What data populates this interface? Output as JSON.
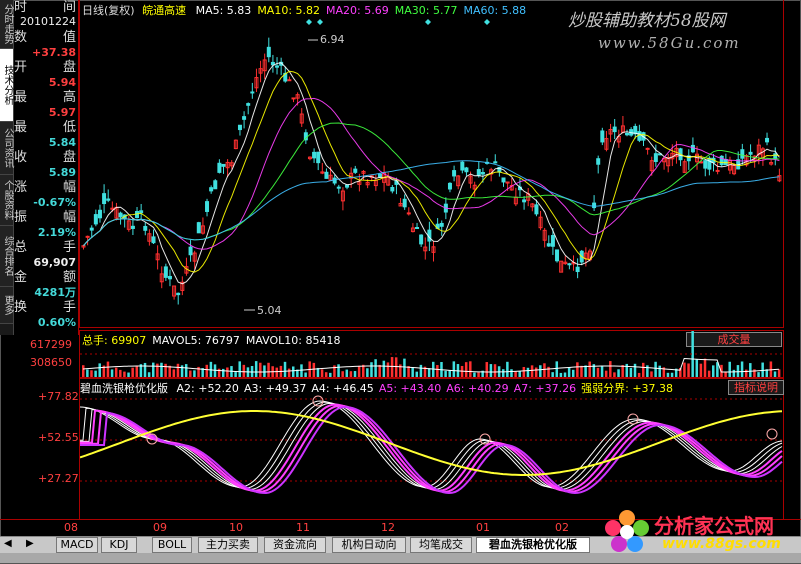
{
  "side_tabs": [
    "分时走势",
    "技术分析",
    "公司资讯",
    "个股资料",
    "综合排名",
    "更多"
  ],
  "info": {
    "time_label_l": "时",
    "time_label_r": "间",
    "date": "20101224",
    "rows": [
      {
        "l": "数",
        "r": "值",
        "v": "+37.38",
        "c": "red"
      },
      {
        "l": "开",
        "r": "盘",
        "v": "5.94",
        "c": "red"
      },
      {
        "l": "最",
        "r": "高",
        "v": "5.97",
        "c": "red"
      },
      {
        "l": "最",
        "r": "低",
        "v": "5.84",
        "c": "cyan"
      },
      {
        "l": "收",
        "r": "盘",
        "v": "5.89",
        "c": "cyan"
      },
      {
        "l": "涨",
        "r": "幅",
        "v": "-0.67%",
        "c": "cyan"
      },
      {
        "l": "振",
        "r": "幅",
        "v": "2.19%",
        "c": "cyan"
      },
      {
        "l": "总",
        "r": "手",
        "v": "69,907",
        "c": "white"
      },
      {
        "l": "金",
        "r": "额",
        "v": "4281万",
        "c": "cyan"
      },
      {
        "l": "换",
        "r": "手",
        "v": "0.60%",
        "c": "cyan"
      }
    ]
  },
  "kline_header": {
    "period": "日线(复权)",
    "name": "皖通高速",
    "ma": [
      {
        "label": "MA5: 5.83",
        "color": "#ffffff"
      },
      {
        "label": "MA10: 5.82",
        "color": "#ffff00"
      },
      {
        "label": "MA20: 5.69",
        "color": "#ff40ff"
      },
      {
        "label": "MA30: 5.77",
        "color": "#40ff40"
      },
      {
        "label": "MA60: 5.88",
        "color": "#40c0ff"
      }
    ],
    "high_mark": "6.94",
    "low_mark": "5.04"
  },
  "volume_header": {
    "items": [
      {
        "label": "总手: 69907",
        "color": "#ffff00"
      },
      {
        "label": "MAVOL5: 76797",
        "color": "#ffffff"
      },
      {
        "label": "MAVOL10: 85418",
        "color": "#ffffff"
      }
    ],
    "button": "成交量",
    "axis": [
      "617299",
      "308650"
    ]
  },
  "indicator_header": {
    "name": "碧血洗银枪优化版",
    "items": [
      {
        "label": "A2: +52.20",
        "color": "#ffffff"
      },
      {
        "label": "A3: +49.37",
        "color": "#ffffff"
      },
      {
        "label": "A4: +46.45",
        "color": "#ffffff"
      },
      {
        "label": "A5: +43.40",
        "color": "#ff40ff"
      },
      {
        "label": "A6: +40.29",
        "color": "#ff40ff"
      },
      {
        "label": "A7: +37.26",
        "color": "#ff40ff"
      },
      {
        "label": "强弱分界: +37.38",
        "color": "#ffff00"
      }
    ],
    "button": "指标说明",
    "axis": [
      "+77.82",
      "+52.55",
      "+27.27"
    ]
  },
  "date_axis": [
    "08",
    "09",
    "10",
    "11",
    "12",
    "01",
    "02"
  ],
  "tabs": [
    "MACD",
    "KDJ",
    "BOLL",
    "主力买卖",
    "资金流向",
    "机构日动向",
    "均笔成交",
    "碧血洗银枪优化版"
  ],
  "active_tab": "碧血洗银枪优化版",
  "watermark_top": "炒股辅助教材58股网",
  "watermark_top_url": "www.58Gu.com",
  "watermark_bottom": "分析家公式网",
  "watermark_bottom_url": "www.88gs.com"
}
